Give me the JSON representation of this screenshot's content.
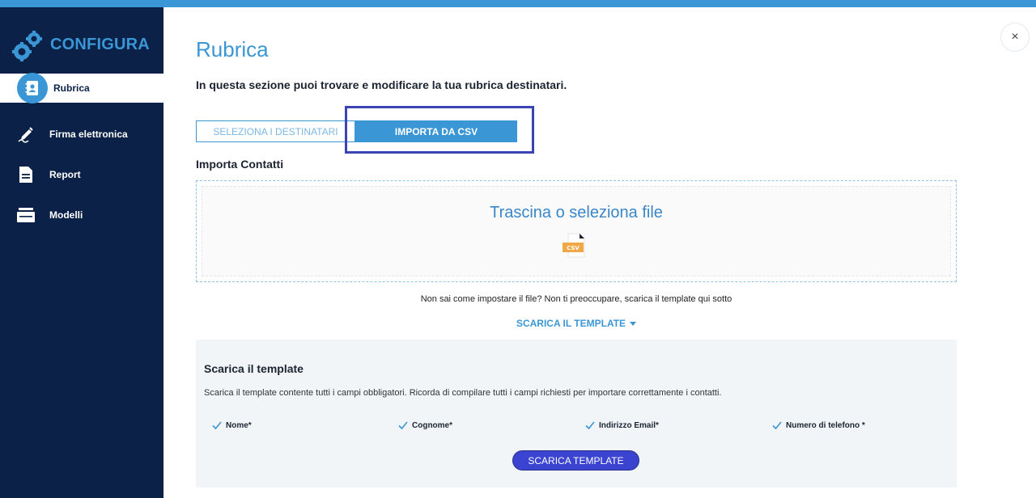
{
  "sidebar": {
    "brand": "CONFIGURA",
    "items": [
      {
        "label": "Rubrica",
        "icon": "address-book-icon",
        "active": true
      },
      {
        "label": "Firma elettronica",
        "icon": "pen-sign-icon",
        "active": false
      },
      {
        "label": "Report",
        "icon": "document-icon",
        "active": false
      },
      {
        "label": "Modelli",
        "icon": "templates-icon",
        "active": false
      }
    ]
  },
  "main": {
    "title": "Rubrica",
    "subtitle": "In questa sezione puoi trovare e modificare la tua rubrica destinatari.",
    "tabs": [
      {
        "label": "SELEZIONA I DESTINATARI",
        "active": false
      },
      {
        "label": "IMPORTA DA CSV",
        "active": true
      }
    ],
    "import_label": "Importa Contatti",
    "dropzone_text": "Trascina o seleziona file",
    "file_badge": "CSV",
    "hint": "Non sai come impostare il file? Non ti preoccupare, scarica il template qui sotto",
    "template_toggle": "SCARICA IL TEMPLATE",
    "close_symbol": "×"
  },
  "template_panel": {
    "title": "Scarica il template",
    "description": "Scarica il template contente tutti i campi obbligatori. Ricorda di compilare tutti i campi richiesti per importare correttamente i contatti.",
    "fields": [
      "Nome*",
      "Cognome*",
      "Indirizzo Email*",
      "Numero di telefono *"
    ],
    "button": "SCARICA TEMPLATE"
  },
  "colors": {
    "accent": "#3a96d4",
    "sidebar_bg": "#0b2147",
    "button_primary": "#3b44d0",
    "highlight": "#3b44b3"
  }
}
